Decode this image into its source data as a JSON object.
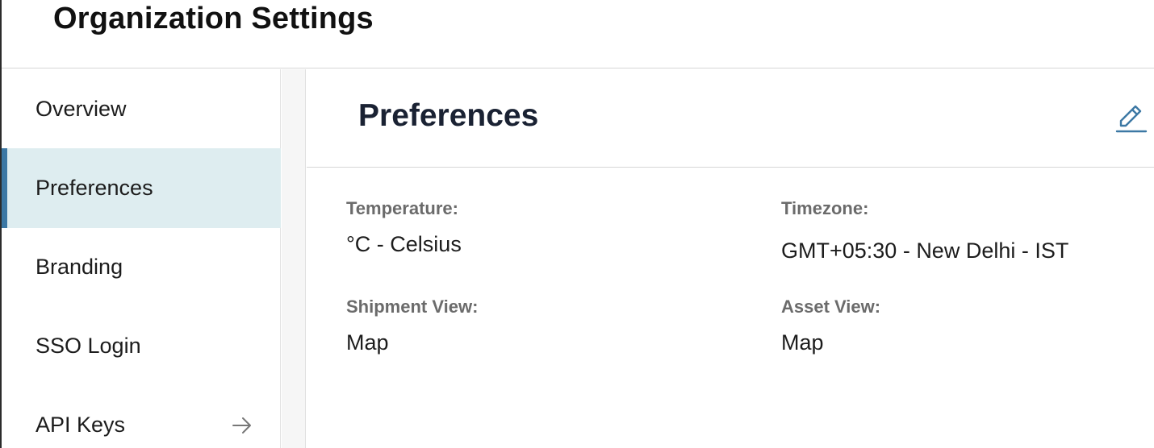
{
  "header": {
    "title": "Organization Settings"
  },
  "sidebar": {
    "items": [
      {
        "label": "Overview"
      },
      {
        "label": "Preferences"
      },
      {
        "label": "Branding"
      },
      {
        "label": "SSO Login"
      },
      {
        "label": "API Keys",
        "icon": "arrow-right-icon"
      }
    ],
    "active_index": 1
  },
  "main": {
    "title": "Preferences",
    "edit_icon": "pencil-icon",
    "fields": {
      "temperature": {
        "label": "Temperature:",
        "value": "°C - Celsius"
      },
      "timezone": {
        "label": "Timezone:",
        "value": "GMT+05:30 - New Delhi - IST"
      },
      "shipment_view": {
        "label": "Shipment View:",
        "value": "Map"
      },
      "asset_view": {
        "label": "Asset View:",
        "value": "Map"
      }
    }
  },
  "colors": {
    "accent": "#3c78a4",
    "active_bg": "#deedf0",
    "label_gray": "#6b6b6b"
  }
}
